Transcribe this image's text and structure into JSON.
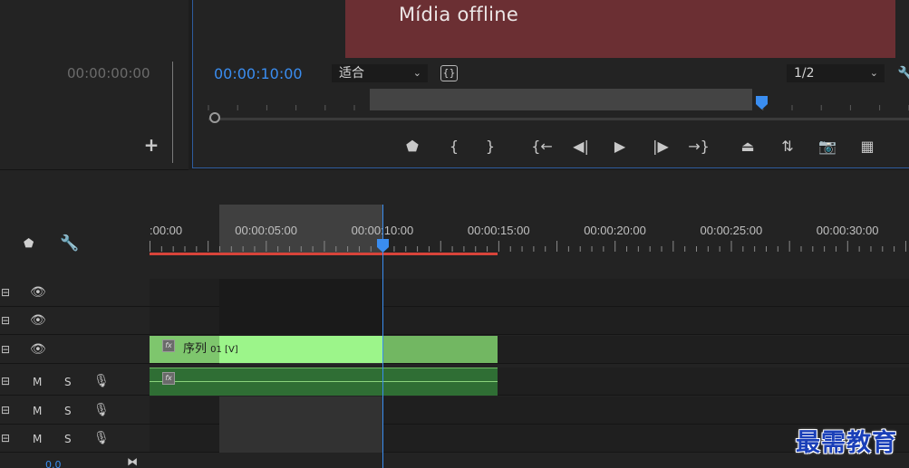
{
  "source_monitor": {
    "timecode": "00:00:00:00",
    "add_icon": "plus-icon"
  },
  "program_monitor": {
    "offline_text": "Mídia offline",
    "timecode": "00:00:10:00",
    "fit_select": "适合",
    "resolution_select": "1/2",
    "playhead_fraction": 0.79,
    "transport": [
      {
        "name": "add-marker-button",
        "glyph": "⬟"
      },
      {
        "name": "mark-in-button",
        "glyph": "{"
      },
      {
        "name": "mark-out-button",
        "glyph": "}"
      },
      {
        "name": "go-to-in-button",
        "glyph": "{←"
      },
      {
        "name": "step-back-button",
        "glyph": "◀|"
      },
      {
        "name": "play-button",
        "glyph": "▶"
      },
      {
        "name": "step-forward-button",
        "glyph": "|▶"
      },
      {
        "name": "go-to-out-button",
        "glyph": "→}"
      },
      {
        "name": "lift-button",
        "glyph": "⏏"
      },
      {
        "name": "extract-button",
        "glyph": "⇅"
      },
      {
        "name": "export-frame-button",
        "glyph": "📷"
      },
      {
        "name": "compare-view-button",
        "glyph": "▦"
      }
    ]
  },
  "timeline": {
    "ruler_labels": [
      ":00:00",
      "00:00:05:00",
      "00:00:10:00",
      "00:00:15:00",
      "00:00:20:00",
      "00:00:25:00",
      "00:00:30:00"
    ],
    "video_tracks": [
      {
        "toggle_icon": "track-output-icon",
        "eye_icon": "eye-icon"
      },
      {
        "toggle_icon": "track-output-icon",
        "eye_icon": "eye-icon"
      },
      {
        "toggle_icon": "track-output-icon",
        "eye_icon": "eye-icon"
      }
    ],
    "audio_tracks": [
      {
        "mute": "M",
        "solo": "S",
        "mic_icon": "microphone-icon"
      },
      {
        "mute": "M",
        "solo": "S",
        "mic_icon": "microphone-icon"
      },
      {
        "mute": "M",
        "solo": "S",
        "mic_icon": "microphone-icon"
      }
    ],
    "video_clip_name": "序列",
    "video_clip_suffix": "01 [V]",
    "fx_label": "fx",
    "bottom_value": "0.0"
  },
  "watermark": "最需教育",
  "colors": {
    "accent_blue": "#3a8df0",
    "clip_green": "#9cf58a",
    "offline_red": "#6b2f33",
    "range_red": "#d8443a"
  }
}
